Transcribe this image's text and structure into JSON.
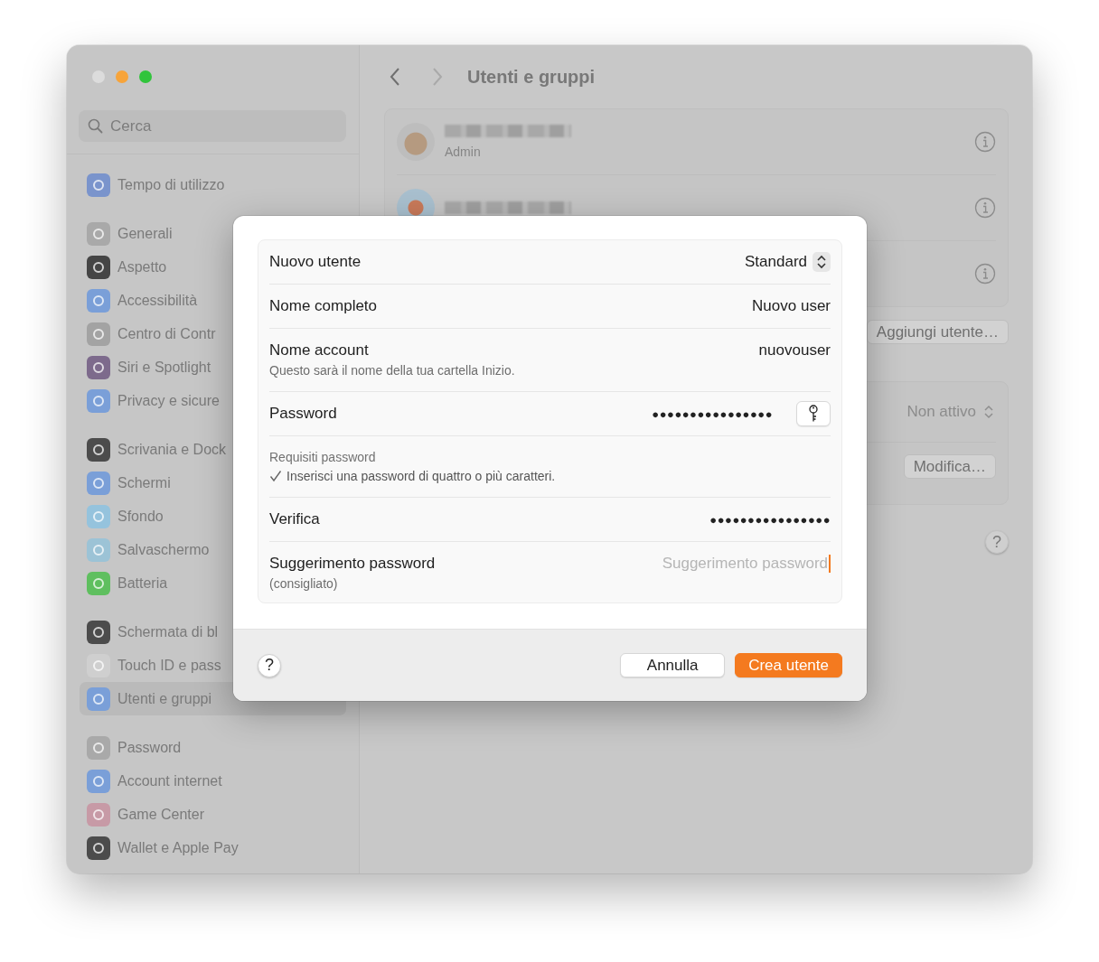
{
  "sidebar": {
    "search": {
      "placeholder": "Cerca"
    },
    "groups": [
      [
        {
          "label": "Tempo di utilizzo",
          "color": "#7a94cc",
          "selected": false
        }
      ],
      [
        {
          "label": "Generali",
          "color": "#a9a9a9",
          "selected": false
        },
        {
          "label": "Aspetto",
          "color": "#454545",
          "selected": false
        },
        {
          "label": "Accessibilità",
          "color": "#7a9fd8",
          "selected": false
        },
        {
          "label": "Centro di Contr",
          "color": "#a3a3a3",
          "selected": false
        },
        {
          "label": "Siri e Spotlight",
          "color": "#7d6a8c",
          "selected": false
        },
        {
          "label": "Privacy e sicure",
          "color": "#7a9fd8",
          "selected": false
        }
      ],
      [
        {
          "label": "Scrivania e Dock",
          "color": "#4c4c4c",
          "selected": false
        },
        {
          "label": "Schermi",
          "color": "#7a9fd8",
          "selected": false
        },
        {
          "label": "Sfondo",
          "color": "#95c3dd",
          "selected": false
        },
        {
          "label": "Salvaschermo",
          "color": "#9cc3d6",
          "selected": false
        },
        {
          "label": "Batteria",
          "color": "#5fbf5f",
          "selected": false
        }
      ],
      [
        {
          "label": "Schermata di bl",
          "color": "#4c4c4c",
          "selected": false
        },
        {
          "label": "Touch ID e pass",
          "color": "#cfcfcf",
          "selected": false
        },
        {
          "label": "Utenti e gruppi",
          "color": "#7a9fd8",
          "selected": true
        }
      ],
      [
        {
          "label": "Password",
          "color": "#a9a9a9",
          "selected": false
        },
        {
          "label": "Account internet",
          "color": "#7a9fd8",
          "selected": false
        },
        {
          "label": "Game Center",
          "color": "#c79aa6",
          "selected": false
        },
        {
          "label": "Wallet e Apple Pay",
          "color": "#4c4c4c",
          "selected": false
        }
      ]
    ]
  },
  "main": {
    "title": "Utenti e gruppi",
    "nav": {
      "back_enabled": true,
      "forward_enabled": false
    },
    "users": [
      {
        "kind": "account",
        "role": "Admin"
      },
      {
        "kind": "account"
      },
      {
        "kind": "covered"
      }
    ],
    "add_user_button": "Aggiungi utente…",
    "settings_card": {
      "popup_value": "Non attivo",
      "popup_disabled": true,
      "edit_button": "Modifica…"
    },
    "help_button": "?"
  },
  "dialog": {
    "rows": [
      {
        "kind": "popup",
        "label": "Nuovo utente",
        "value": "Standard"
      },
      {
        "kind": "text",
        "label": "Nome completo",
        "value": "Nuovo user"
      },
      {
        "kind": "text",
        "label": "Nome account",
        "note": "Questo sarà il nome della tua cartella Inizio.",
        "value": "nuovouser"
      },
      {
        "kind": "password",
        "label": "Password",
        "value": "●●●●●●●●●●●●●●●●",
        "key_button": true
      },
      {
        "kind": "requirements",
        "title": "Requisiti password",
        "items": [
          {
            "text": "Inserisci una password di quattro o più caratteri.",
            "met": true
          }
        ]
      },
      {
        "kind": "password",
        "label": "Verifica",
        "value": "●●●●●●●●●●●●●●●●"
      },
      {
        "kind": "input",
        "label": "Suggerimento password",
        "note": "(consigliato)",
        "placeholder": "Suggerimento password",
        "focused": true
      }
    ],
    "help_button": "?",
    "buttons": [
      {
        "label": "Annulla",
        "default": false
      },
      {
        "label": "Crea utente",
        "default": true
      }
    ]
  }
}
